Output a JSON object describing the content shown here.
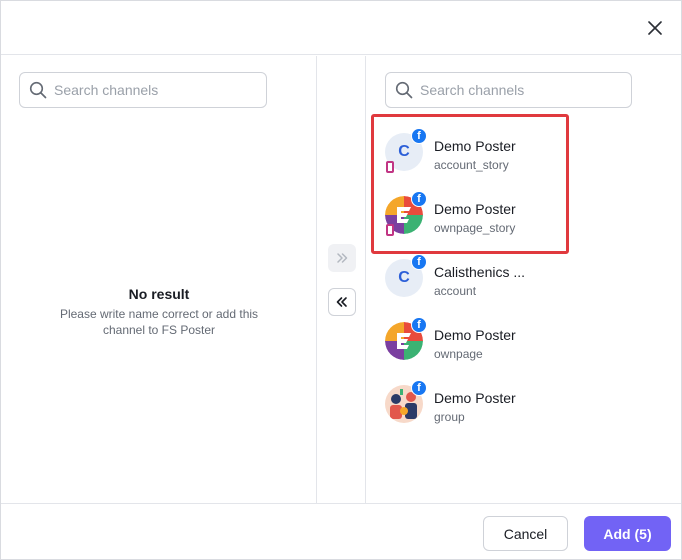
{
  "left_panel": {
    "search_placeholder": "Search channels",
    "empty_title": "No result",
    "empty_description": "Please write name correct or add this channel to FS Poster"
  },
  "right_panel": {
    "search_placeholder": "Search channels",
    "channels": [
      {
        "name": "Demo Poster",
        "type": "account_story",
        "avatar": "letter",
        "avatar_letter": "C",
        "network": "facebook",
        "story": true
      },
      {
        "name": "Demo Poster",
        "type": "ownpage_story",
        "avatar": "brand-logo",
        "network": "facebook",
        "story": true
      },
      {
        "name": "Calisthenics ...",
        "type": "account",
        "avatar": "letter",
        "avatar_letter": "C",
        "network": "facebook",
        "story": false
      },
      {
        "name": "Demo Poster",
        "type": "ownpage",
        "avatar": "brand-logo",
        "network": "facebook",
        "story": false
      },
      {
        "name": "Demo Poster",
        "type": "group",
        "avatar": "illustration",
        "network": "facebook",
        "story": false
      }
    ]
  },
  "icons": {
    "close": "close-icon",
    "search": "search-icon",
    "move_right": "double-chevron-right-icon",
    "move_left": "double-chevron-left-icon",
    "network_badge": "facebook-icon",
    "story_badge": "instagram-story-icon"
  },
  "footer": {
    "cancel_label": "Cancel",
    "add_label": "Add (5)"
  },
  "colors": {
    "accent": "#7263f5",
    "facebook": "#1877f2",
    "highlight": "#e0393e",
    "letter_avatar": "#2c5fd8"
  }
}
